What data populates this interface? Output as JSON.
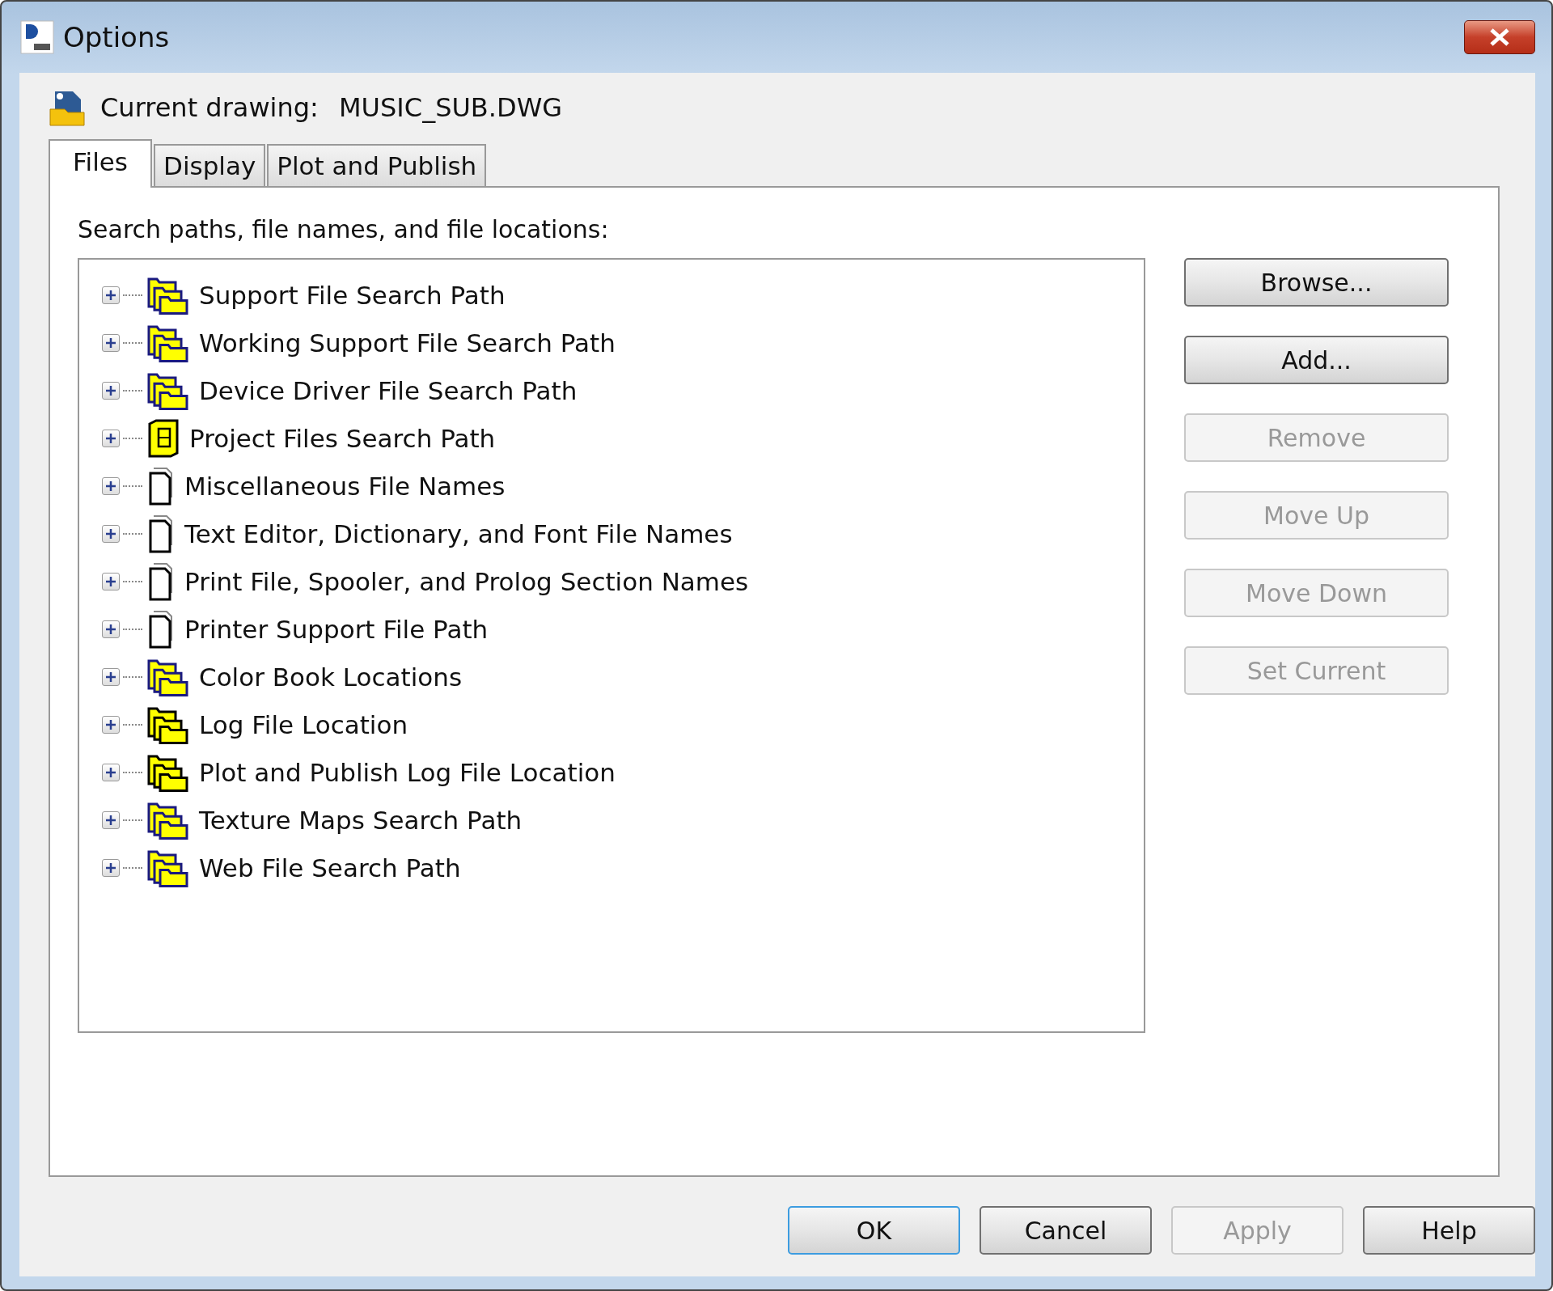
{
  "window": {
    "title": "Options"
  },
  "current_drawing": {
    "label": "Current drawing:",
    "value": "MUSIC_SUB.DWG"
  },
  "tabs": [
    {
      "label": "Files",
      "selected": true
    },
    {
      "label": "Display",
      "selected": false
    },
    {
      "label": "Plot and Publish",
      "selected": false
    }
  ],
  "tree": {
    "label": "Search paths, file names, and file locations:",
    "items": [
      {
        "label": "Support File Search Path",
        "kind": "folders",
        "expanded": false
      },
      {
        "label": "Working Support File Search Path",
        "kind": "folders",
        "expanded": false
      },
      {
        "label": "Device Driver File Search Path",
        "kind": "folders",
        "expanded": false
      },
      {
        "label": "Project Files Search Path",
        "kind": "book",
        "expanded": false
      },
      {
        "label": "Miscellaneous File Names",
        "kind": "documents",
        "expanded": false
      },
      {
        "label": "Text Editor, Dictionary, and Font File Names",
        "kind": "documents",
        "expanded": false
      },
      {
        "label": "Print File, Spooler, and Prolog Section Names",
        "kind": "documents",
        "expanded": false
      },
      {
        "label": "Printer Support File Path",
        "kind": "documents",
        "expanded": false
      },
      {
        "label": "Color Book Locations",
        "kind": "folders",
        "expanded": false
      },
      {
        "label": "Log File Location",
        "kind": "dark-folders",
        "expanded": false
      },
      {
        "label": "Plot and Publish Log File Location",
        "kind": "dark-folders",
        "expanded": false
      },
      {
        "label": "Texture Maps Search Path",
        "kind": "folders",
        "expanded": false
      },
      {
        "label": "Web File Search Path",
        "kind": "folders",
        "expanded": false
      }
    ]
  },
  "side_buttons": [
    {
      "label": "Browse...",
      "disabled": false
    },
    {
      "label": "Add...",
      "disabled": false
    },
    {
      "label": "Remove",
      "disabled": true
    },
    {
      "label": "Move Up",
      "disabled": true
    },
    {
      "label": "Move Down",
      "disabled": true
    },
    {
      "label": "Set Current",
      "disabled": true
    }
  ],
  "footer_buttons": [
    {
      "label": "OK",
      "disabled": false,
      "default": true
    },
    {
      "label": "Cancel",
      "disabled": false,
      "default": false
    },
    {
      "label": "Apply",
      "disabled": true,
      "default": false
    },
    {
      "label": "Help",
      "disabled": false,
      "default": false
    }
  ]
}
